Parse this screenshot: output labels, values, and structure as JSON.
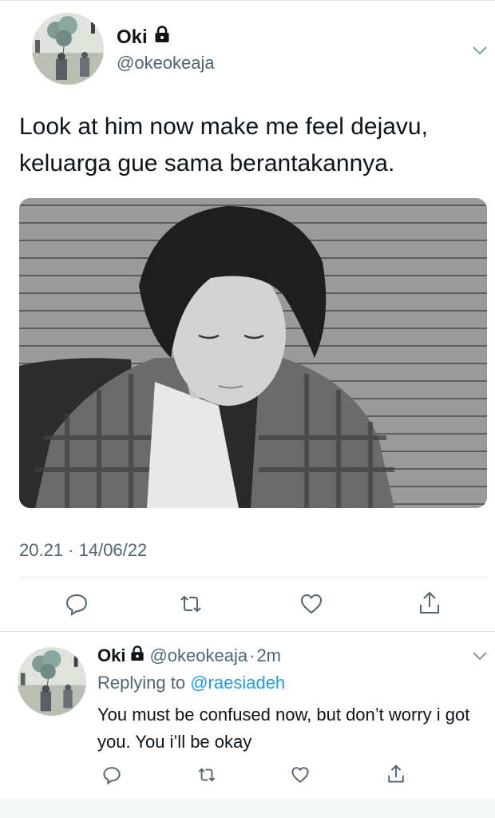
{
  "main_tweet": {
    "display_name": "Oki",
    "handle": "@okeokeaja",
    "text": "Look at him now make me feel dejavu, keluarga gue sama berantakannya.",
    "timestamp": "20.21 · 14/06/22",
    "icons": {
      "lock": "lock-icon",
      "more": "chevron-down-icon",
      "reply": "reply-icon",
      "retweet": "retweet-icon",
      "like": "heart-icon",
      "share": "share-icon"
    }
  },
  "reply_tweet": {
    "display_name": "Oki",
    "handle": "@okeokeaja",
    "separator": "·",
    "time": "2m",
    "replying_prefix": "Replying to",
    "replying_to": "@raesiadeh",
    "text": "You must be confused now, but don’t worry i got you. You i’ll be okay"
  },
  "colors": {
    "text_primary": "#0f1419",
    "text_secondary": "#536471",
    "link": "#1d9bf0",
    "divider": "#e1e4e6"
  }
}
